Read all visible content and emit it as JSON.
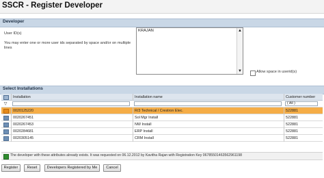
{
  "page": {
    "title": "SSCR - Register Developer"
  },
  "developer": {
    "section_title": "Developer",
    "user_label": "User ID(s)",
    "user_hint": "You may enter one or more user ids separated by space and/or on multiple lines",
    "user_value": "KRAJAN",
    "allow_space_label": "Allow space in userid(s)"
  },
  "installations": {
    "section_title": "Select Installations",
    "columns": [
      "Installation",
      "Installation name",
      "Customer number"
    ],
    "filter_all": "( All )",
    "rows": [
      {
        "installation": "0020125220",
        "name": "R/3 Technical / Crestron Elec.",
        "customer": "522881",
        "selected": true
      },
      {
        "installation": "0020267451",
        "name": "Sol Mgr Install",
        "customer": "522881",
        "selected": false
      },
      {
        "installation": "0020267453",
        "name": "NW Install",
        "customer": "522881",
        "selected": false
      },
      {
        "installation": "0020284681",
        "name": "ERP Install",
        "customer": "522881",
        "selected": false
      },
      {
        "installation": "0020305145",
        "name": "CRM Install",
        "customer": "522881",
        "selected": false
      }
    ]
  },
  "message": {
    "text": "The developer with these attributes already exists. It was requested on 06.12.2012 by Kavitha Rajan with Registration Key 06785501463562961198"
  },
  "buttons": {
    "register": "Register",
    "reset": "Reset",
    "registered": "Developers Registered by Me",
    "cancel": "Cancel"
  }
}
